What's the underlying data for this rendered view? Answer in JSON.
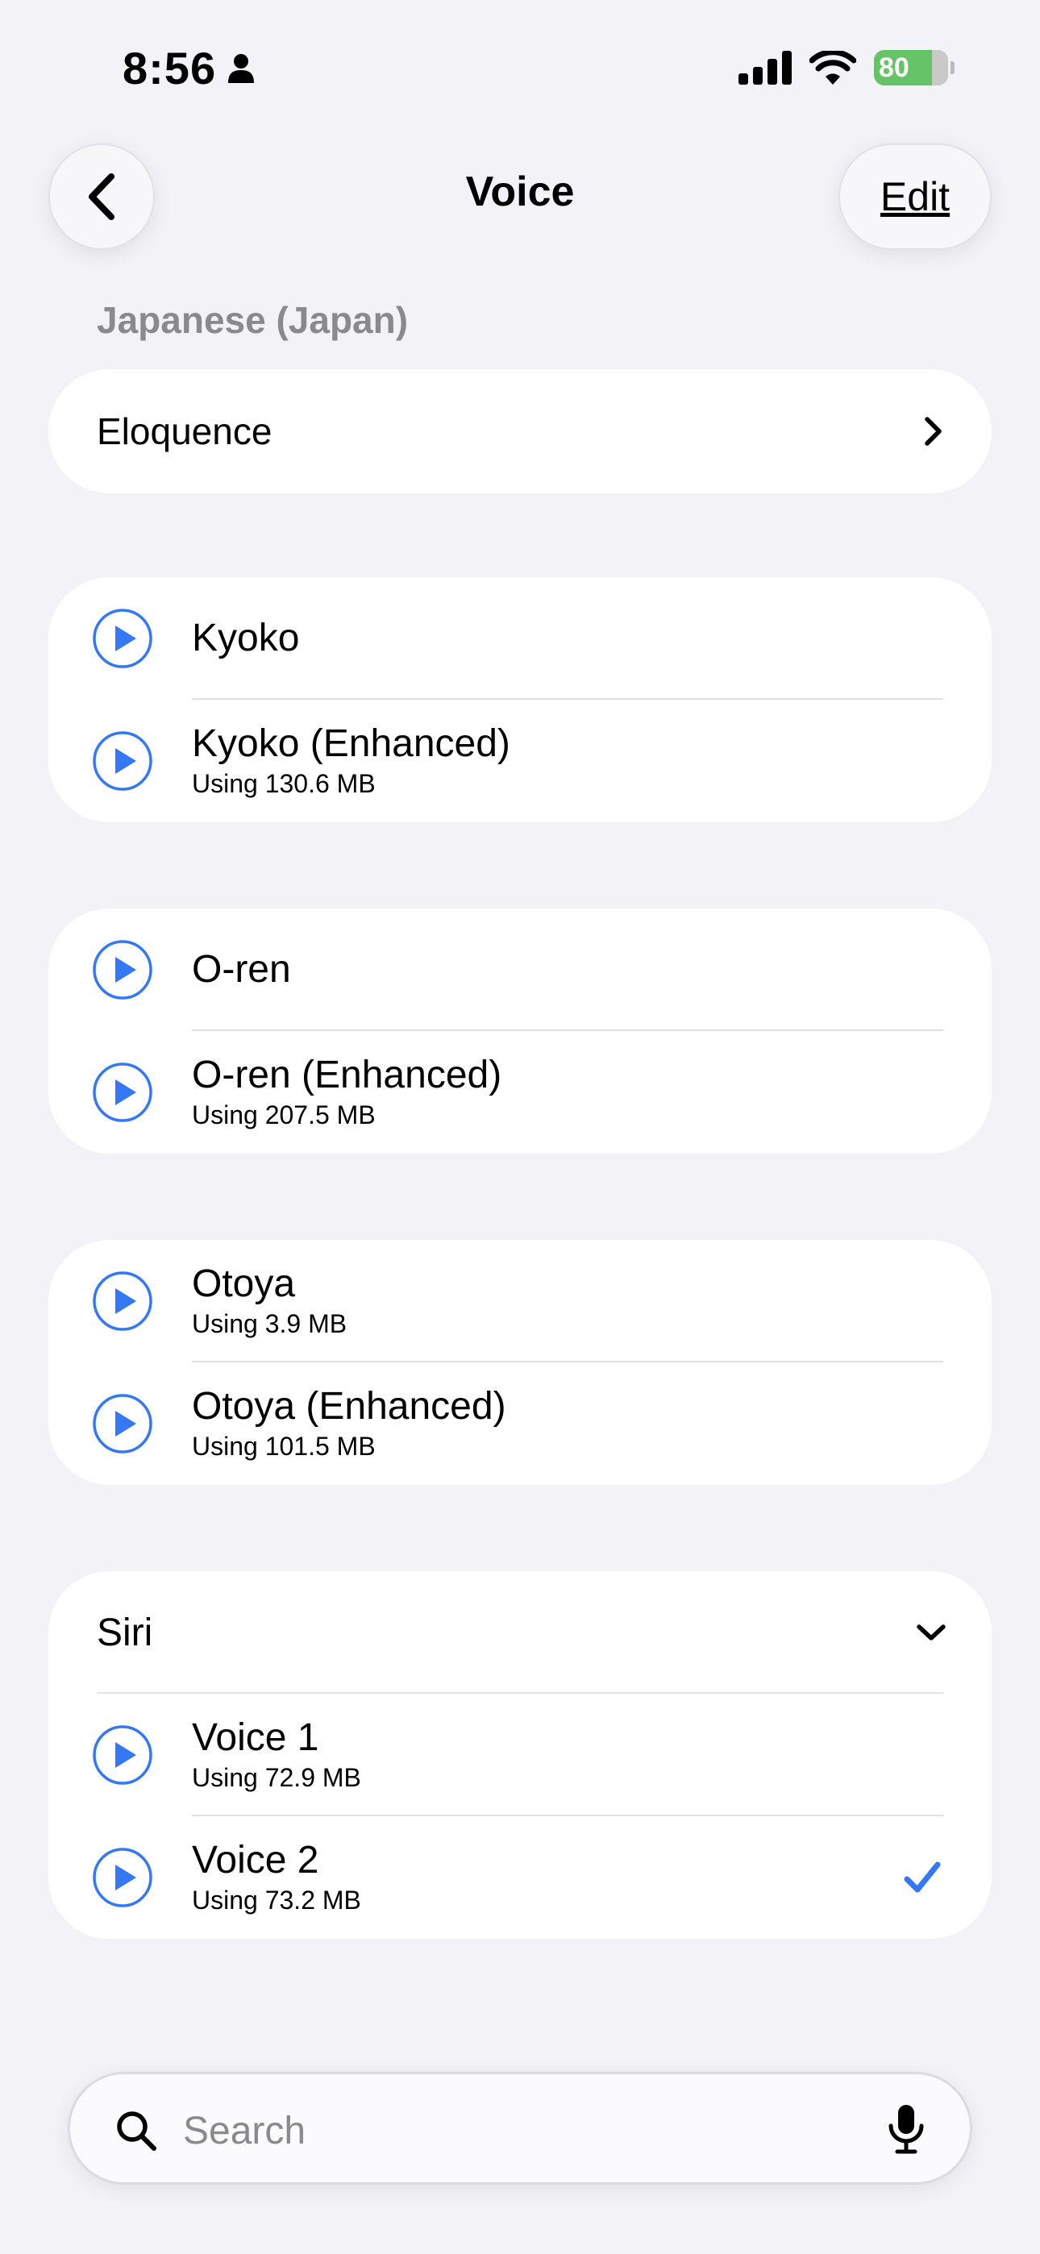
{
  "status": {
    "time": "8:56",
    "battery": "80"
  },
  "nav": {
    "title": "Voice",
    "edit_label": "Edit"
  },
  "section_header": "Japanese (Japan)",
  "eloquence_label": "Eloquence",
  "groups": [
    {
      "voices": [
        {
          "name": "Kyoko",
          "sub": ""
        },
        {
          "name": "Kyoko (Enhanced)",
          "sub": "Using 130.6 MB"
        }
      ]
    },
    {
      "voices": [
        {
          "name": "O-ren",
          "sub": ""
        },
        {
          "name": "O-ren (Enhanced)",
          "sub": "Using 207.5 MB"
        }
      ]
    },
    {
      "voices": [
        {
          "name": "Otoya",
          "sub": "Using 3.9 MB"
        },
        {
          "name": "Otoya (Enhanced)",
          "sub": "Using 101.5 MB"
        }
      ]
    }
  ],
  "siri": {
    "label": "Siri",
    "voices": [
      {
        "name": "Voice 1",
        "sub": "Using 72.9 MB"
      },
      {
        "name": "Voice 2",
        "sub": "Using 73.2 MB",
        "selected": true
      }
    ]
  },
  "search": {
    "placeholder": "Search"
  },
  "colors": {
    "accent": "#3478f6",
    "battery": "#65c466",
    "background": "#f2f2f7"
  },
  "icons": [
    "person-icon",
    "signal-icon",
    "wifi-icon",
    "battery-icon",
    "back-chevron-icon",
    "chevron-right-icon",
    "play-icon",
    "chevron-down-icon",
    "checkmark-icon",
    "search-icon",
    "microphone-icon"
  ]
}
